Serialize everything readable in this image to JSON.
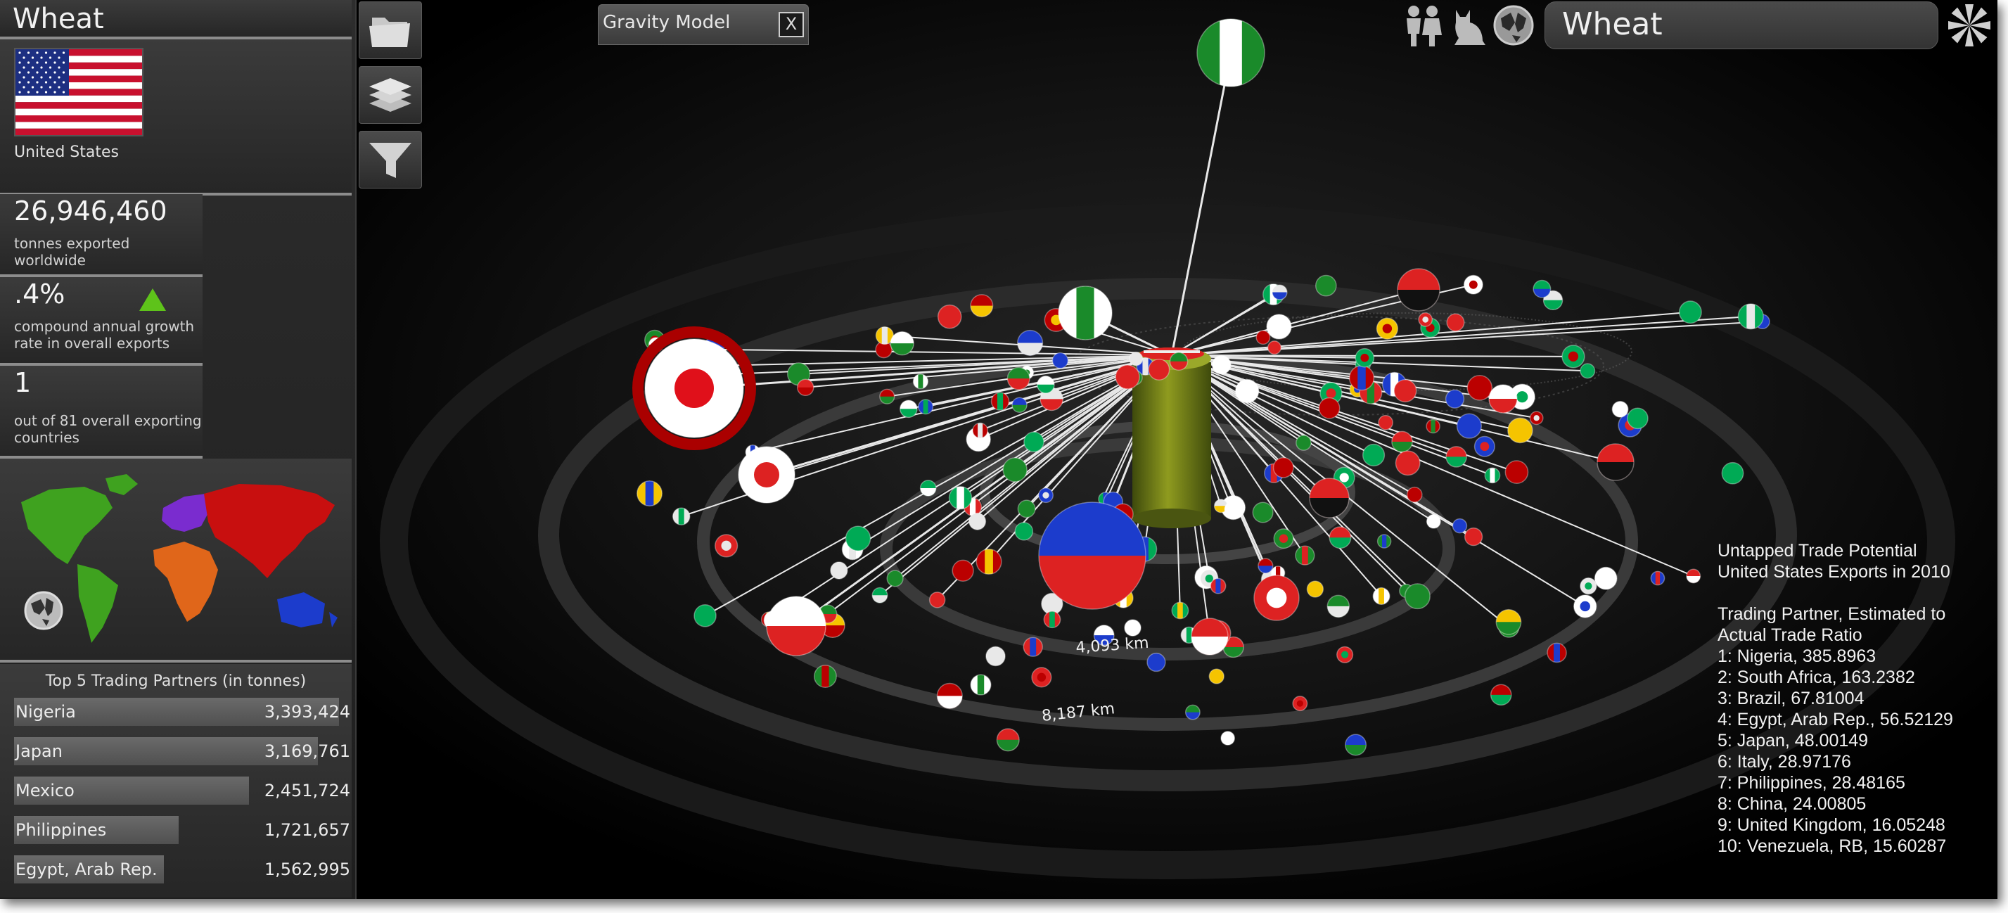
{
  "sidebar": {
    "product": "Wheat",
    "country": "United States",
    "stats": [
      {
        "value": "26,946,460",
        "label": "tonnes exported worldwide"
      },
      {
        "value": ".4%",
        "label": "compound annual growth rate in overall exports"
      },
      {
        "value": "1",
        "label": "out of 81 overall exporting countries"
      }
    ],
    "top_partners_title": "Top 5 Trading Partners (in tonnes)",
    "top_partners": [
      {
        "name": "Nigeria",
        "value": "3,393,424",
        "tonnes": 3393424
      },
      {
        "name": "Japan",
        "value": "3,169,761",
        "tonnes": 3169761
      },
      {
        "name": "Mexico",
        "value": "2,451,724",
        "tonnes": 2451724
      },
      {
        "name": "Philippines",
        "value": "1,721,657",
        "tonnes": 1721657
      },
      {
        "name": "Egypt, Arab Rep.",
        "value": "1,562,995",
        "tonnes": 1562995
      }
    ],
    "growth_indicator_color": "#5ec31a"
  },
  "tab": {
    "title": "Gravity Model",
    "close_label": "X"
  },
  "search": {
    "value": "Wheat"
  },
  "icons": [
    "folder-icon",
    "layers-icon",
    "filter-icon",
    "people-icon",
    "cat-icon",
    "globe-icon",
    "fan-icon"
  ],
  "distances": [
    "4,093 km",
    "8,187 km"
  ],
  "info": {
    "line1": "Untapped Trade Potential",
    "line2": "United States Exports in 2010",
    "line3": "Trading Partner, Estimated to",
    "line4": "Actual Trade Ratio",
    "ranks": [
      "1: Nigeria, 385.8963",
      "2: South Africa, 163.2382",
      "3: Brazil, 67.81004",
      "4: Egypt, Arab Rep., 56.52129",
      "5: Japan, 48.00149",
      "6: Italy, 28.97176",
      "7: Philippines, 28.48165",
      "8: China, 24.00805",
      "9: United Kingdom, 16.05248",
      "10: Venezuela, RB, 15.60287"
    ]
  },
  "map_colors": {
    "americas": "#3fa21f",
    "europe": "#7a2ccf",
    "africa": "#e0661a",
    "asia": "#c80f0f",
    "oceania": "#1c3ccc"
  }
}
